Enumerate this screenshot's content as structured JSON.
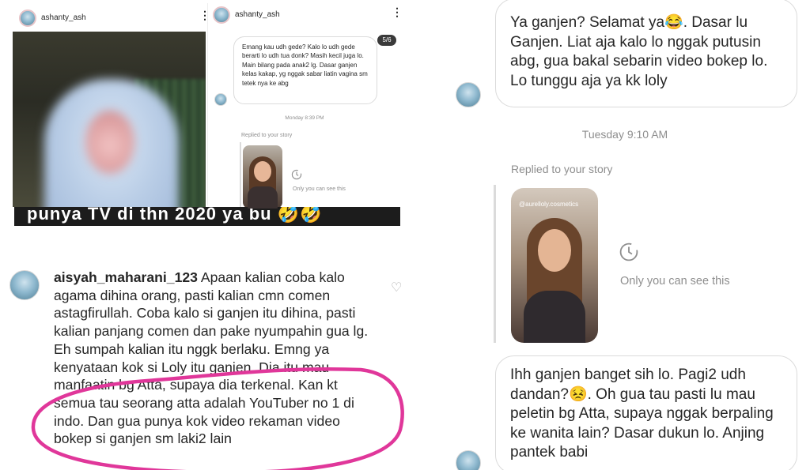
{
  "top_left": {
    "username": "ashanty_ash"
  },
  "top_middle": {
    "username": "ashanty_ash",
    "page_counter": "5/6",
    "message": "Emang kau udh gede? Kalo lo udh gede berarti lo udh tua donk? Masih kecil juga lo. Main bilang pada anak2 lg. Dasar ganjen kelas kakap, yg nggak sabar liatin vagina sm tetek nya ke abg",
    "timestamp": "Monday 8:39 PM",
    "replied_label": "Replied to your story",
    "only_you_label": "Only you can see this"
  },
  "caption": {
    "text": "punya TV di thn 2020 ya bu 🤣🤣"
  },
  "comment": {
    "username": "aisyah_maharani_123",
    "text": "Apaan kalian coba kalo agama dihina orang, pasti kalian cmn comen astagfirullah. Coba kalo si ganjen itu dihina, pasti kalian panjang comen dan pake nyumpahin gua lg. Eh sumpah kalian itu nggk berlaku. Emng ya kenyataan kok si Loly itu ganjen. Dia itu mau manfaatin bg Atta, supaya dia terkenal. Kan kt semua tau seorang atta adalah YouTuber no 1 di indo. Dan gua punya kok video rekaman video bokep si ganjen sm laki2 lain"
  },
  "right_panel": {
    "message_1": "Ya ganjen? Selamat ya😂. Dasar lu Ganjen. Liat aja kalo lo nggak putusin abg, gua bakal sebarin video bokep lo. Lo tunggu aja ya kk loly",
    "timestamp": "Tuesday 9:10 AM",
    "replied_label": "Replied to your story",
    "story_tag": "@aurelloly.cosmetics",
    "only_you_label": "Only you can see this",
    "message_2": "Ihh ganjen banget sih lo.  Pagi2 udh dandan?😣. Oh gua tau pasti lu mau peletin bg Atta, supaya nggak berpaling ke wanita lain? Dasar dukun lo. Anjing pantek babi"
  },
  "colors": {
    "text": "#262626",
    "muted": "#8e8e8e",
    "bubble_border": "#dbdbdb",
    "annotation_circle": "#e0379a"
  },
  "icons": [
    "kebab-icon",
    "clock-icon",
    "heart-icon"
  ]
}
